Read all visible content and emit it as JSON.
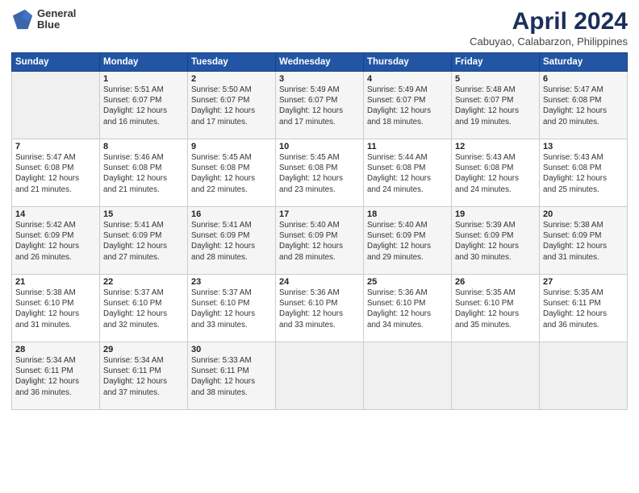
{
  "header": {
    "logo_text_line1": "General",
    "logo_text_line2": "Blue",
    "title": "April 2024",
    "subtitle": "Cabuyao, Calabarzon, Philippines"
  },
  "days_of_week": [
    "Sunday",
    "Monday",
    "Tuesday",
    "Wednesday",
    "Thursday",
    "Friday",
    "Saturday"
  ],
  "weeks": [
    [
      {
        "day": "",
        "detail": ""
      },
      {
        "day": "1",
        "detail": "Sunrise: 5:51 AM\nSunset: 6:07 PM\nDaylight: 12 hours\nand 16 minutes."
      },
      {
        "day": "2",
        "detail": "Sunrise: 5:50 AM\nSunset: 6:07 PM\nDaylight: 12 hours\nand 17 minutes."
      },
      {
        "day": "3",
        "detail": "Sunrise: 5:49 AM\nSunset: 6:07 PM\nDaylight: 12 hours\nand 17 minutes."
      },
      {
        "day": "4",
        "detail": "Sunrise: 5:49 AM\nSunset: 6:07 PM\nDaylight: 12 hours\nand 18 minutes."
      },
      {
        "day": "5",
        "detail": "Sunrise: 5:48 AM\nSunset: 6:07 PM\nDaylight: 12 hours\nand 19 minutes."
      },
      {
        "day": "6",
        "detail": "Sunrise: 5:47 AM\nSunset: 6:08 PM\nDaylight: 12 hours\nand 20 minutes."
      }
    ],
    [
      {
        "day": "7",
        "detail": "Sunrise: 5:47 AM\nSunset: 6:08 PM\nDaylight: 12 hours\nand 21 minutes."
      },
      {
        "day": "8",
        "detail": "Sunrise: 5:46 AM\nSunset: 6:08 PM\nDaylight: 12 hours\nand 21 minutes."
      },
      {
        "day": "9",
        "detail": "Sunrise: 5:45 AM\nSunset: 6:08 PM\nDaylight: 12 hours\nand 22 minutes."
      },
      {
        "day": "10",
        "detail": "Sunrise: 5:45 AM\nSunset: 6:08 PM\nDaylight: 12 hours\nand 23 minutes."
      },
      {
        "day": "11",
        "detail": "Sunrise: 5:44 AM\nSunset: 6:08 PM\nDaylight: 12 hours\nand 24 minutes."
      },
      {
        "day": "12",
        "detail": "Sunrise: 5:43 AM\nSunset: 6:08 PM\nDaylight: 12 hours\nand 24 minutes."
      },
      {
        "day": "13",
        "detail": "Sunrise: 5:43 AM\nSunset: 6:08 PM\nDaylight: 12 hours\nand 25 minutes."
      }
    ],
    [
      {
        "day": "14",
        "detail": "Sunrise: 5:42 AM\nSunset: 6:09 PM\nDaylight: 12 hours\nand 26 minutes."
      },
      {
        "day": "15",
        "detail": "Sunrise: 5:41 AM\nSunset: 6:09 PM\nDaylight: 12 hours\nand 27 minutes."
      },
      {
        "day": "16",
        "detail": "Sunrise: 5:41 AM\nSunset: 6:09 PM\nDaylight: 12 hours\nand 28 minutes."
      },
      {
        "day": "17",
        "detail": "Sunrise: 5:40 AM\nSunset: 6:09 PM\nDaylight: 12 hours\nand 28 minutes."
      },
      {
        "day": "18",
        "detail": "Sunrise: 5:40 AM\nSunset: 6:09 PM\nDaylight: 12 hours\nand 29 minutes."
      },
      {
        "day": "19",
        "detail": "Sunrise: 5:39 AM\nSunset: 6:09 PM\nDaylight: 12 hours\nand 30 minutes."
      },
      {
        "day": "20",
        "detail": "Sunrise: 5:38 AM\nSunset: 6:09 PM\nDaylight: 12 hours\nand 31 minutes."
      }
    ],
    [
      {
        "day": "21",
        "detail": "Sunrise: 5:38 AM\nSunset: 6:10 PM\nDaylight: 12 hours\nand 31 minutes."
      },
      {
        "day": "22",
        "detail": "Sunrise: 5:37 AM\nSunset: 6:10 PM\nDaylight: 12 hours\nand 32 minutes."
      },
      {
        "day": "23",
        "detail": "Sunrise: 5:37 AM\nSunset: 6:10 PM\nDaylight: 12 hours\nand 33 minutes."
      },
      {
        "day": "24",
        "detail": "Sunrise: 5:36 AM\nSunset: 6:10 PM\nDaylight: 12 hours\nand 33 minutes."
      },
      {
        "day": "25",
        "detail": "Sunrise: 5:36 AM\nSunset: 6:10 PM\nDaylight: 12 hours\nand 34 minutes."
      },
      {
        "day": "26",
        "detail": "Sunrise: 5:35 AM\nSunset: 6:10 PM\nDaylight: 12 hours\nand 35 minutes."
      },
      {
        "day": "27",
        "detail": "Sunrise: 5:35 AM\nSunset: 6:11 PM\nDaylight: 12 hours\nand 36 minutes."
      }
    ],
    [
      {
        "day": "28",
        "detail": "Sunrise: 5:34 AM\nSunset: 6:11 PM\nDaylight: 12 hours\nand 36 minutes."
      },
      {
        "day": "29",
        "detail": "Sunrise: 5:34 AM\nSunset: 6:11 PM\nDaylight: 12 hours\nand 37 minutes."
      },
      {
        "day": "30",
        "detail": "Sunrise: 5:33 AM\nSunset: 6:11 PM\nDaylight: 12 hours\nand 38 minutes."
      },
      {
        "day": "",
        "detail": ""
      },
      {
        "day": "",
        "detail": ""
      },
      {
        "day": "",
        "detail": ""
      },
      {
        "day": "",
        "detail": ""
      }
    ]
  ]
}
